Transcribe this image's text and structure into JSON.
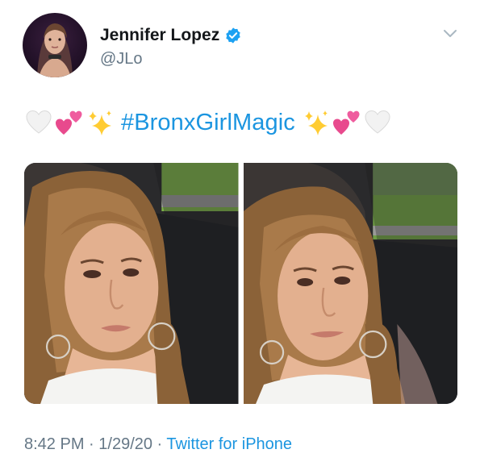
{
  "author": {
    "display_name": "Jennifer Lopez",
    "handle": "@JLo",
    "verified": true,
    "avatar_icon": "profile-photo"
  },
  "tweet": {
    "emojis_before": [
      "white-heart",
      "two-hearts",
      "sparkles"
    ],
    "hashtag": "#BronxGirlMagic",
    "emojis_after": [
      "sparkles",
      "two-hearts",
      "white-heart"
    ]
  },
  "media": {
    "photo_count": 2
  },
  "meta": {
    "time": "8:42 PM",
    "separator": " · ",
    "date": "1/29/20",
    "source": "Twitter for iPhone"
  },
  "colors": {
    "link": "#1b95e0",
    "secondary_text": "#657786",
    "verified_badge": "#1da1f2"
  }
}
